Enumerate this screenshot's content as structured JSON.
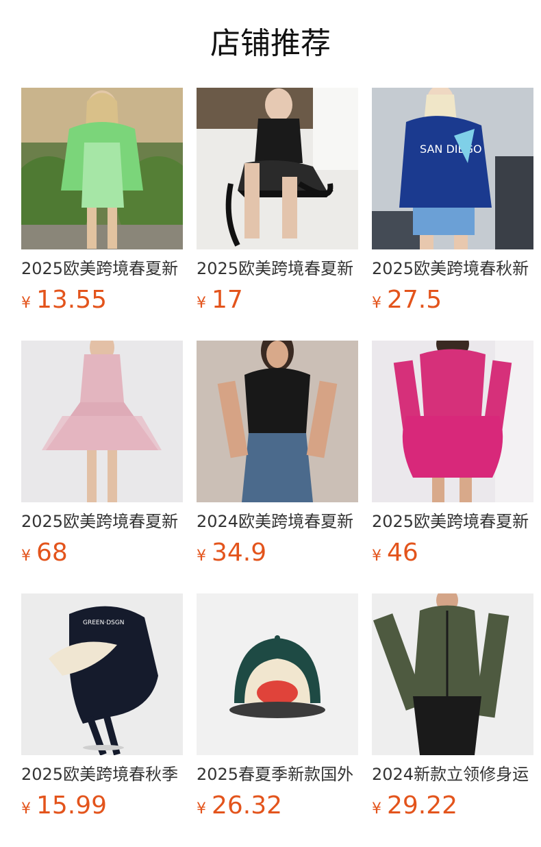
{
  "header": {
    "title": "店铺推荐"
  },
  "currency_symbol": "¥",
  "accent_color": "#e3541c",
  "products": [
    {
      "title": "2025欧美跨境春夏新",
      "price": "13.55",
      "image": "green-lace-outfit-photo"
    },
    {
      "title": "2025欧美跨境春夏新",
      "price": "17",
      "image": "black-ribbon-top-photo"
    },
    {
      "title": "2025欧美跨境春秋新",
      "price": "27.5",
      "image": "blue-hoodie-photo"
    },
    {
      "title": "2025欧美跨境春夏新",
      "price": "68",
      "image": "pink-tulle-dress-photo"
    },
    {
      "title": "2024欧美跨境春夏新",
      "price": "34.9",
      "image": "black-corset-top-photo"
    },
    {
      "title": "2025欧美跨境春夏新",
      "price": "46",
      "image": "magenta-bubble-dress-photo"
    },
    {
      "title": "2025欧美跨境春秋季",
      "price": "15.99",
      "image": "navy-headscarf-cap-photo"
    },
    {
      "title": "2025春夏季新款国外",
      "price": "26.32",
      "image": "green-character-cap-photo"
    },
    {
      "title": "2024新款立领修身运",
      "price": "29.22",
      "image": "olive-zip-jacket-photo"
    }
  ]
}
